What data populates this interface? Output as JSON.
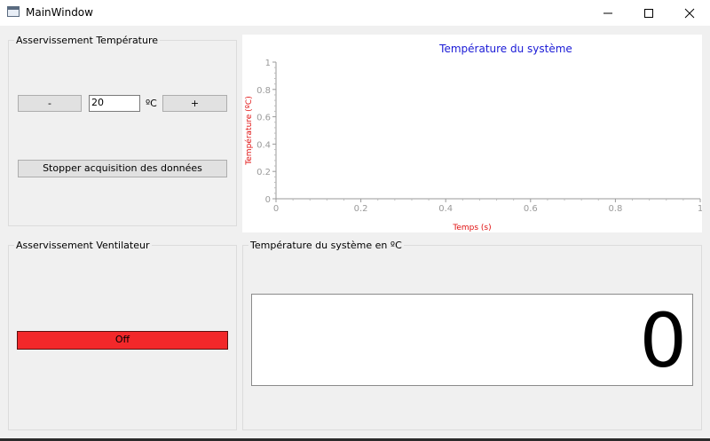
{
  "window": {
    "title": "MainWindow"
  },
  "temperature_control": {
    "group_title": "Asservissement Température",
    "minus_label": "-",
    "plus_label": "+",
    "setpoint_value": "20",
    "unit": "ºC",
    "stop_label": "Stopper acquisition des données"
  },
  "fan_control": {
    "group_title": "Asservissement Ventilateur",
    "toggle_label": "Off",
    "toggle_color": "#f2282a"
  },
  "display": {
    "group_title": "Température du système en ºC",
    "value": "0"
  },
  "chart_data": {
    "type": "line",
    "title": "Température du système",
    "xlabel": "Temps (s)",
    "ylabel": "Température (ºC)",
    "xlim": [
      0,
      1
    ],
    "ylim": [
      0,
      1
    ],
    "x_ticks": [
      "0",
      "0.2",
      "0.4",
      "0.6",
      "0.8",
      "1"
    ],
    "y_ticks": [
      "0",
      "0.2",
      "0.4",
      "0.6",
      "0.8",
      "1"
    ],
    "series": [],
    "title_color": "#1a1ad6",
    "label_color": "#e01010",
    "grid": false
  }
}
